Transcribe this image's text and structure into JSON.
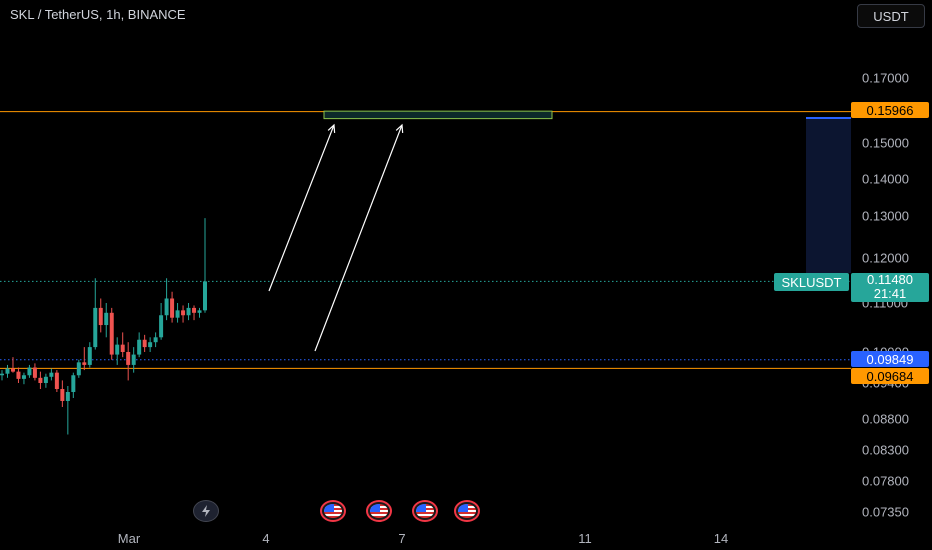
{
  "header": {
    "title": "SKL / TetherUS, 1h, BINANCE",
    "currency": "USDT"
  },
  "y_ticks": [
    "0.17000",
    "0.15000",
    "0.14000",
    "0.13000",
    "0.12000",
    "0.11000",
    "0.10000",
    "0.09400",
    "0.08800",
    "0.08300",
    "0.07800",
    "0.07350"
  ],
  "x_ticks": [
    "Mar",
    "4",
    "7",
    "11",
    "14"
  ],
  "price_labels": {
    "resistance": "0.15966",
    "support": "0.09684",
    "blue_line": "0.09849",
    "symbol": "SKLUSDT",
    "current": "0.11480",
    "countdown": "21:41"
  },
  "colors": {
    "background": "#000000",
    "up": "#26a69a",
    "down": "#ef5350",
    "level": "#ff9800",
    "blue": "#2962ff",
    "zone_border": "#8bc34a",
    "zone_fill": "#0d2a2a"
  },
  "icons": {
    "event_flash": "lightning-icon",
    "event_economic": "us-flag-icon"
  },
  "chart_data": {
    "type": "candlestick",
    "title": "SKL / TetherUS, 1h, BINANCE",
    "xlabel": "",
    "ylabel": "",
    "x_ticks": [
      "Mar",
      "4",
      "7",
      "11",
      "14"
    ],
    "y_ticks": [
      0.17,
      0.15,
      0.14,
      0.13,
      0.12,
      0.11,
      0.1,
      0.094,
      0.088,
      0.083,
      0.078,
      0.0735
    ],
    "ylim": [
      0.0735,
      0.178
    ],
    "log_scale": true,
    "grid": false,
    "horizontal_levels": [
      {
        "name": "resistance",
        "value": 0.15966,
        "style": "solid",
        "color": "#ff9800"
      },
      {
        "name": "support",
        "value": 0.09684,
        "style": "solid",
        "color": "#ff9800"
      },
      {
        "name": "blue level",
        "value": 0.09849,
        "style": "dotted",
        "color": "#2962ff"
      },
      {
        "name": "current price",
        "value": 0.1148,
        "style": "dotted",
        "color": "#26a69a"
      }
    ],
    "target_zone": {
      "y_low": 0.1575,
      "y_high": 0.1598
    },
    "annotations": [
      "two white arrows pointing up from ~0.107 and ~0.118 to target zone near 0.159"
    ],
    "ohlc_approx": [
      [
        0.0955,
        0.0965,
        0.0945,
        0.0958
      ],
      [
        0.0958,
        0.0975,
        0.095,
        0.0968
      ],
      [
        0.0968,
        0.099,
        0.096,
        0.0962
      ],
      [
        0.0962,
        0.097,
        0.094,
        0.0948
      ],
      [
        0.0948,
        0.096,
        0.0938,
        0.0955
      ],
      [
        0.0955,
        0.0975,
        0.095,
        0.097
      ],
      [
        0.097,
        0.0978,
        0.0945,
        0.095
      ],
      [
        0.095,
        0.0962,
        0.093,
        0.094
      ],
      [
        0.094,
        0.0958,
        0.0932,
        0.0952
      ],
      [
        0.0952,
        0.0968,
        0.0945,
        0.096
      ],
      [
        0.096,
        0.0965,
        0.0925,
        0.093
      ],
      [
        0.093,
        0.0945,
        0.09,
        0.091
      ],
      [
        0.091,
        0.0935,
        0.0855,
        0.0925
      ],
      [
        0.0925,
        0.096,
        0.0915,
        0.0955
      ],
      [
        0.0955,
        0.0985,
        0.095,
        0.098
      ],
      [
        0.098,
        0.101,
        0.0965,
        0.0975
      ],
      [
        0.0975,
        0.102,
        0.097,
        0.101
      ],
      [
        0.101,
        0.1155,
        0.1005,
        0.109
      ],
      [
        0.109,
        0.111,
        0.104,
        0.1055
      ],
      [
        0.1055,
        0.11,
        0.103,
        0.108
      ],
      [
        0.108,
        0.109,
        0.0985,
        0.0995
      ],
      [
        0.0995,
        0.103,
        0.0975,
        0.1015
      ],
      [
        0.1015,
        0.104,
        0.099,
        0.1
      ],
      [
        0.1,
        0.102,
        0.0945,
        0.0975
      ],
      [
        0.0975,
        0.101,
        0.096,
        0.0995
      ],
      [
        0.0995,
        0.104,
        0.099,
        0.1025
      ],
      [
        0.1025,
        0.1035,
        0.1,
        0.101
      ],
      [
        0.101,
        0.103,
        0.1,
        0.102
      ],
      [
        0.102,
        0.104,
        0.101,
        0.103
      ],
      [
        0.103,
        0.11,
        0.1025,
        0.1075
      ],
      [
        0.1075,
        0.1155,
        0.1065,
        0.111
      ],
      [
        0.111,
        0.1125,
        0.106,
        0.107
      ],
      [
        0.107,
        0.11,
        0.106,
        0.1085
      ],
      [
        0.1085,
        0.1095,
        0.106,
        0.1075
      ],
      [
        0.1075,
        0.11,
        0.1065,
        0.109
      ],
      [
        0.109,
        0.1095,
        0.1065,
        0.108
      ],
      [
        0.108,
        0.109,
        0.107,
        0.1085
      ],
      [
        0.1085,
        0.1295,
        0.108,
        0.1148
      ]
    ]
  }
}
